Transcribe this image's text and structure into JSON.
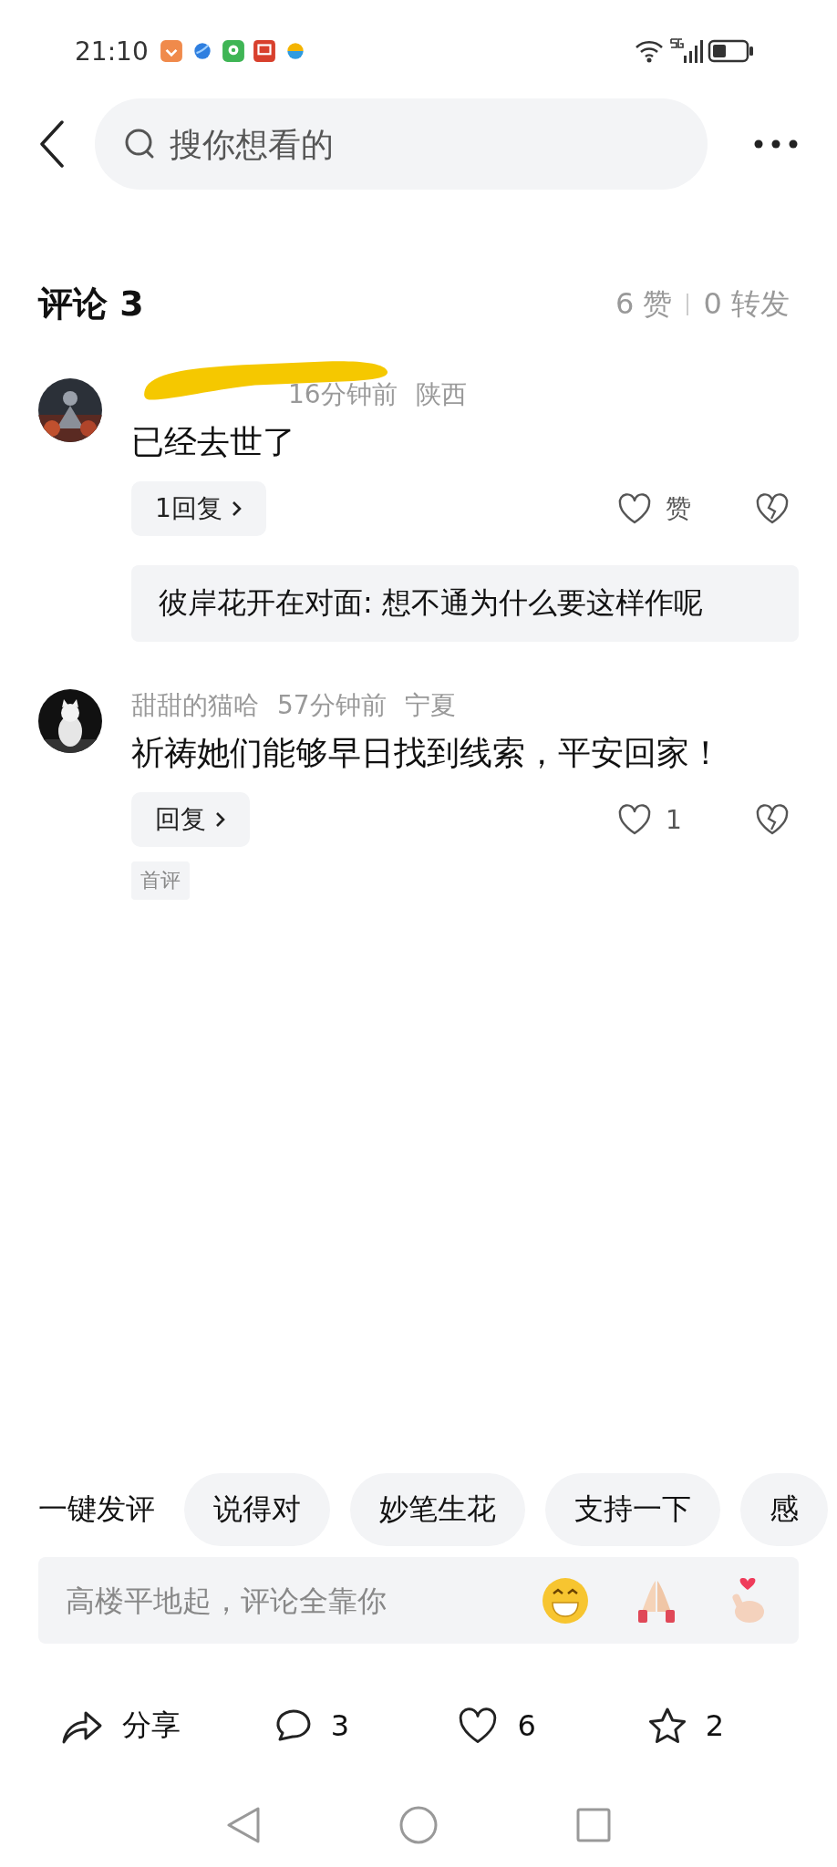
{
  "status_bar": {
    "time": "21:10"
  },
  "search": {
    "placeholder": "搜你想看的"
  },
  "comments_header": {
    "title": "评论 3",
    "likes": "6 赞",
    "reposts": "0 转发"
  },
  "comments": [
    {
      "name_redacted": true,
      "time": "16分钟前",
      "region": "陕西",
      "text": "已经去世了",
      "reply_button": "1回复",
      "like_label": "赞",
      "liked": false,
      "reply_preview": "彼岸花开在对面: 想不通为什么要这样作呢"
    },
    {
      "name": "甜甜的猫哈",
      "name_redacted": false,
      "time": "57分钟前",
      "region": "宁夏",
      "text": "祈祷她们能够早日找到线索，平安回家！",
      "reply_button": "回复",
      "like_label": "1",
      "liked": false,
      "tag": "首评"
    }
  ],
  "quick_comments": {
    "label": "一键发评",
    "chips": [
      "说得对",
      "妙笔生花",
      "支持一下",
      "感"
    ]
  },
  "comment_input": {
    "placeholder": "高楼平地起，评论全靠你"
  },
  "action_bar": {
    "share": "分享",
    "comments": "3",
    "likes": "6",
    "favorites": "2"
  }
}
